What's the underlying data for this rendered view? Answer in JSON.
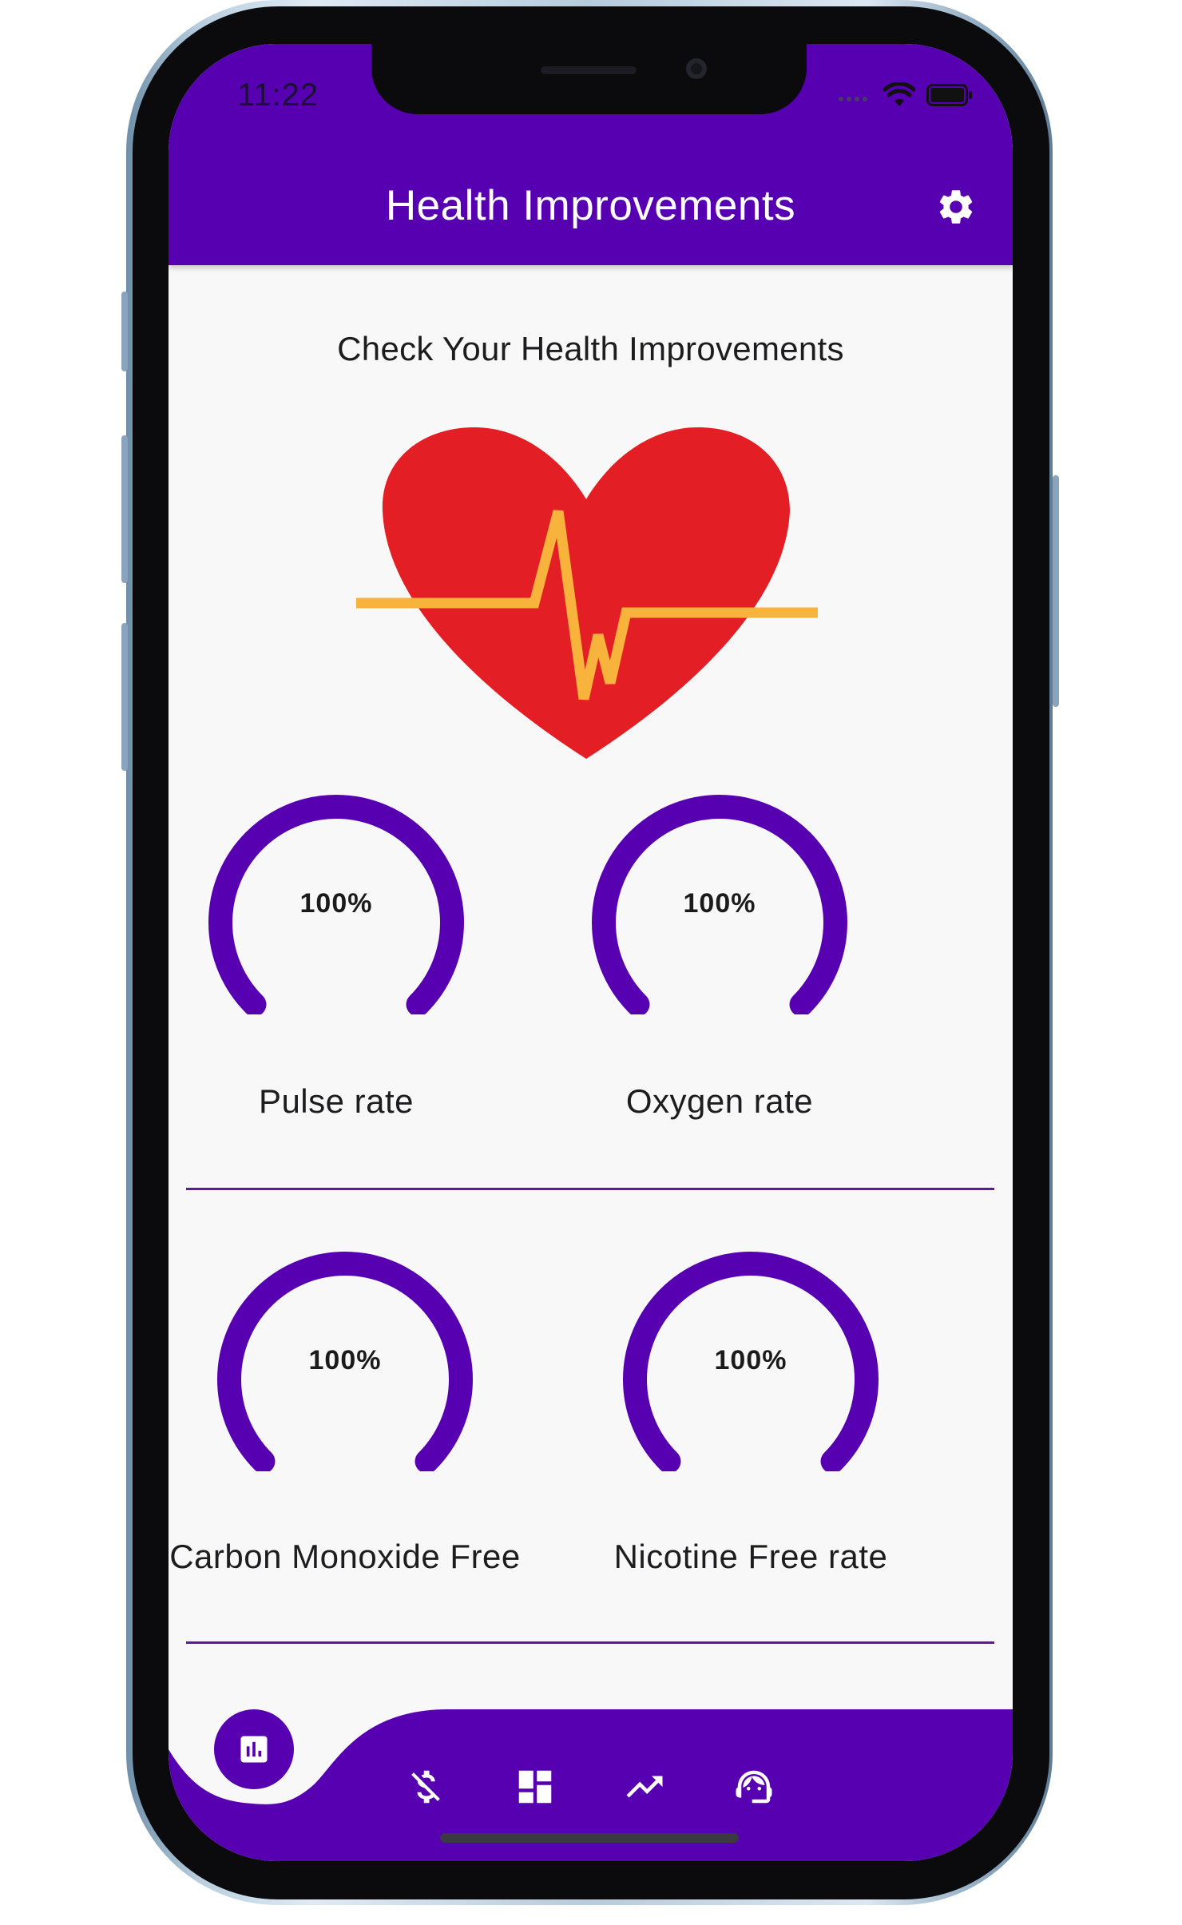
{
  "status_bar": {
    "time": "11:22"
  },
  "app_bar": {
    "title": "Health Improvements",
    "settings_icon": "gear-icon"
  },
  "main": {
    "subtitle": "Check Your Health Improvements",
    "illustration": "heart-pulse-illustration",
    "metrics": [
      {
        "value": "100%",
        "label": "Pulse rate",
        "level": 1.0
      },
      {
        "value": "100%",
        "label": "Oxygen rate",
        "level": 1.0
      },
      {
        "value": "100%",
        "label": "Carbon Monoxide Free",
        "level": 1.0
      },
      {
        "value": "100%",
        "label": "Nicotine Free rate",
        "level": 1.0
      }
    ]
  },
  "bottom_nav": {
    "items": [
      {
        "icon": "bar-chart-icon",
        "active": true
      },
      {
        "icon": "money-off-icon",
        "active": false
      },
      {
        "icon": "dashboard-icon",
        "active": false
      },
      {
        "icon": "trending-up-icon",
        "active": false
      },
      {
        "icon": "support-agent-icon",
        "active": false
      }
    ]
  },
  "colors": {
    "primary": "#5700b1",
    "background": "#f8f8f8",
    "heart": "#e31f25",
    "pulse_line": "#f7b33c",
    "text": "#1d1d1f"
  }
}
